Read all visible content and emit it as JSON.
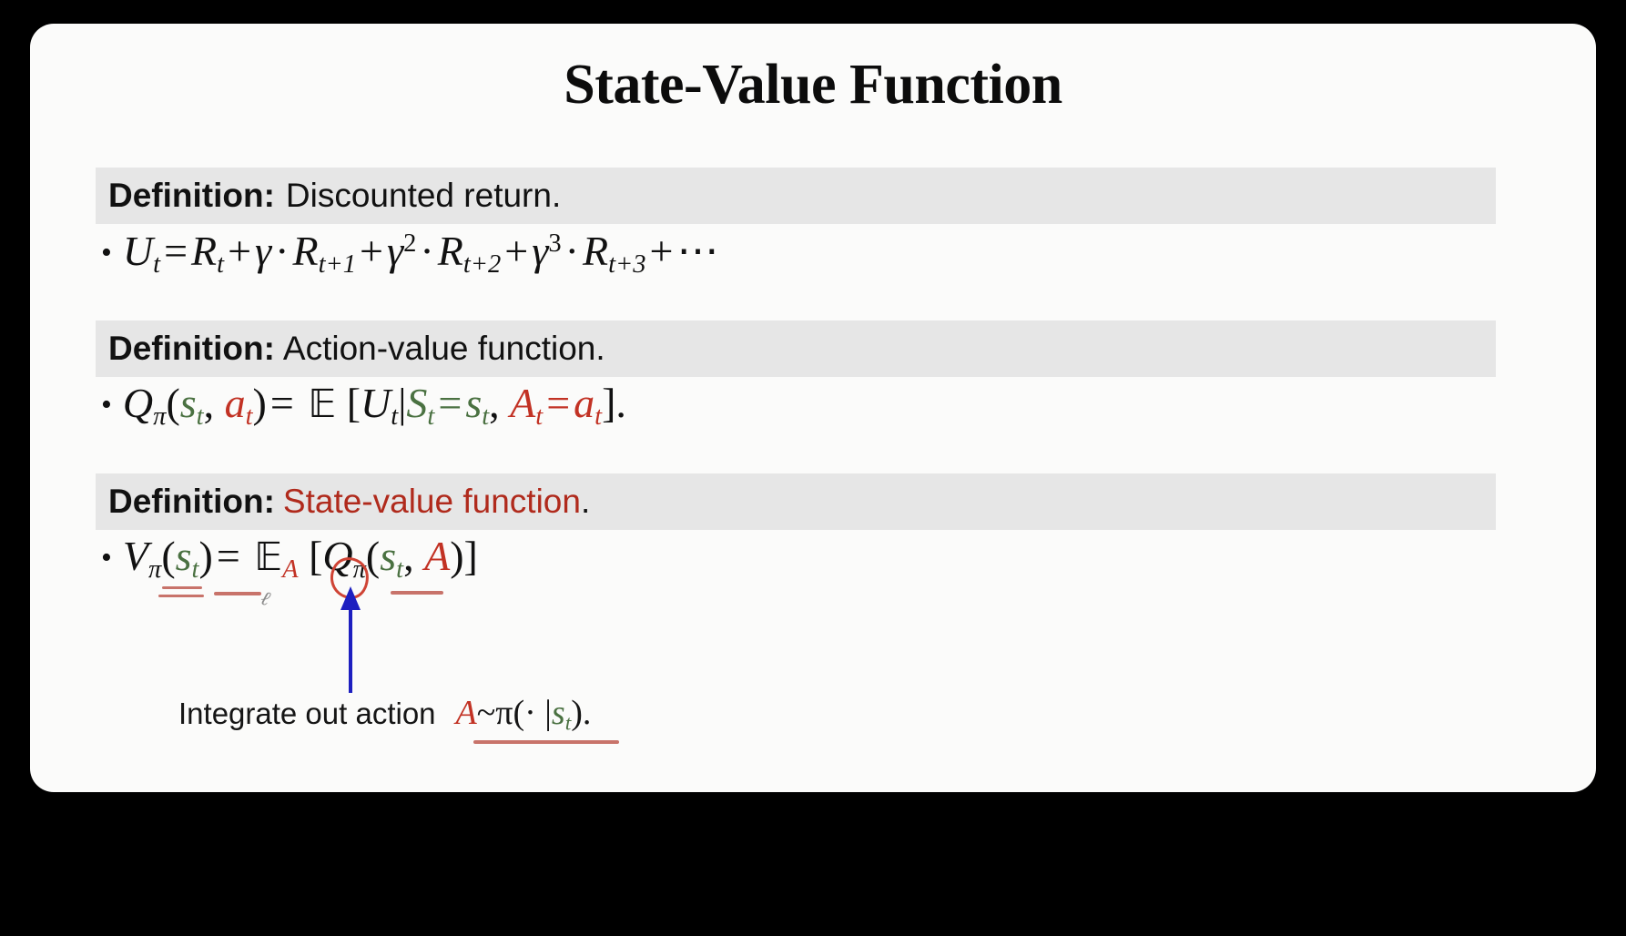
{
  "slide": {
    "title": "State-Value Function",
    "background_color": "#fbfbfa",
    "page_background_color": "#000000"
  },
  "colors": {
    "definition_bar": "#e6e6e6",
    "state_green": "#4a7141",
    "action_red": "#c23224",
    "heading_red": "#b02a1c",
    "annotation_red": "#cf4435",
    "arrow_blue": "#1d1fc0"
  },
  "definitions": [
    {
      "label": "Definition:",
      "text": "Discounted return.",
      "text_color": "black",
      "formula_parts": {
        "bullet": "•",
        "lhs": "U",
        "lhs_sub": "t",
        "eq": "=",
        "term1": "R",
        "term1_sub": "t",
        "plus": "+",
        "gamma": "γ",
        "dot": "·",
        "term2": "R",
        "term2_sub": "t+1",
        "gamma_sq_exp": "2",
        "term3": "R",
        "term3_sub": "t+2",
        "gamma_cu_exp": "3",
        "term4": "R",
        "term4_sub": "t+3",
        "ellipsis": "⋯"
      }
    },
    {
      "label": "Definition:",
      "text": "Action-value function.",
      "text_color": "black",
      "formula_parts": {
        "bullet": "•",
        "Q": "Q",
        "pi": "π",
        "lparen": "(",
        "s": "s",
        "s_sub": "t",
        "comma": ",",
        "a": "a",
        "a_sub": "t",
        "rparen": ")",
        "eq": "=",
        "E": "ᴇ",
        "expectation": "𝔼",
        "lbracket": "[",
        "U": "U",
        "U_sub": "t",
        "bar": "|",
        "S": "S",
        "S_sub": "t",
        "eq2": "=",
        "s2": "s",
        "s2_sub": "t",
        "comma2": ",",
        "A": "A",
        "A_sub": "t",
        "eq3": "=",
        "a2": "a",
        "a2_sub": "t",
        "rbracket": "]",
        "period": "."
      }
    },
    {
      "label": "Definition:",
      "text": "State-value function",
      "text_color": "#b02a1c",
      "text_suffix": ".",
      "formula_parts": {
        "bullet": "•",
        "V": "V",
        "pi": "π",
        "lparen": "(",
        "s": "s",
        "s_sub": "t",
        "rparen": ")",
        "eq": "=",
        "expectation": "𝔼",
        "exp_sub_A": "A",
        "lbracket": "[",
        "Q": "Q",
        "Q_pi": "π",
        "lparen2": "(",
        "s2": "s",
        "s2_sub": "t",
        "comma": ",",
        "A": "A",
        "rparen2": ")",
        "rbracket": "]"
      }
    }
  ],
  "annotation": {
    "note_text": "Integrate out action",
    "note_math_A": "A",
    "note_math_rest": "~π(· |",
    "note_math_s": "s",
    "note_math_s_sub": "t",
    "note_math_close": ").",
    "squiggle_glyph": "ℓ"
  }
}
